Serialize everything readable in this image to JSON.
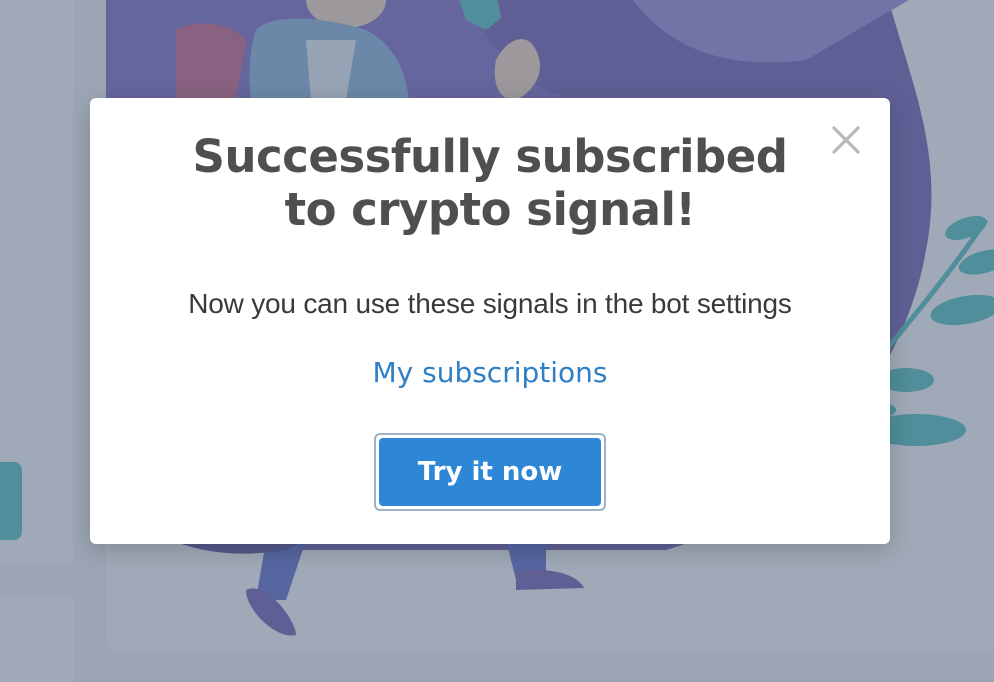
{
  "modal": {
    "title": "Successfully subscribed to crypto signal!",
    "subtitle": "Now you can use these signals in the bot settings",
    "link_label": "My subscriptions",
    "button_label": "Try it now",
    "close_icon": "close-icon"
  },
  "colors": {
    "primary_button": "#2e86d6",
    "link": "#2f7fc7",
    "title_text": "#4f4f4f",
    "overlay": "#64748b",
    "teal_accent": "#2fb8b3",
    "illustration_purple": "#5b3ea6"
  }
}
